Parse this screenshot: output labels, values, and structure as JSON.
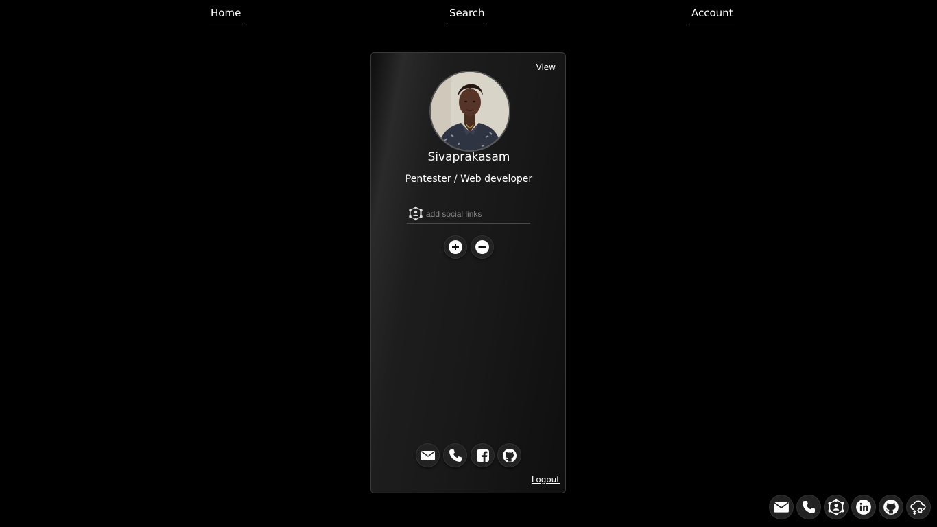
{
  "nav": {
    "home": "Home",
    "search": "Search",
    "account": "Account"
  },
  "card": {
    "view_label": "View",
    "avatar_icon": "profile-photo",
    "name": "Sivaprakasam",
    "role": "Pentester / Web developer",
    "social_input": {
      "placeholder": "add social links",
      "value": "",
      "icon": "network-icon"
    },
    "actions": {
      "add_icon": "plus-icon",
      "remove_icon": "minus-icon"
    },
    "social_links": [
      "mail-icon",
      "phone-icon",
      "facebook-icon",
      "github-icon"
    ],
    "logout_label": "Logout"
  },
  "dock": {
    "icons": [
      "mail-icon",
      "phone-icon",
      "network-icon",
      "linkedin-icon",
      "github-icon",
      "cloud-settings-icon"
    ]
  },
  "colors": {
    "background": "#000000",
    "card_border": "#3a3a3a",
    "text": "#ffffff",
    "placeholder": "#8a8a8a"
  }
}
